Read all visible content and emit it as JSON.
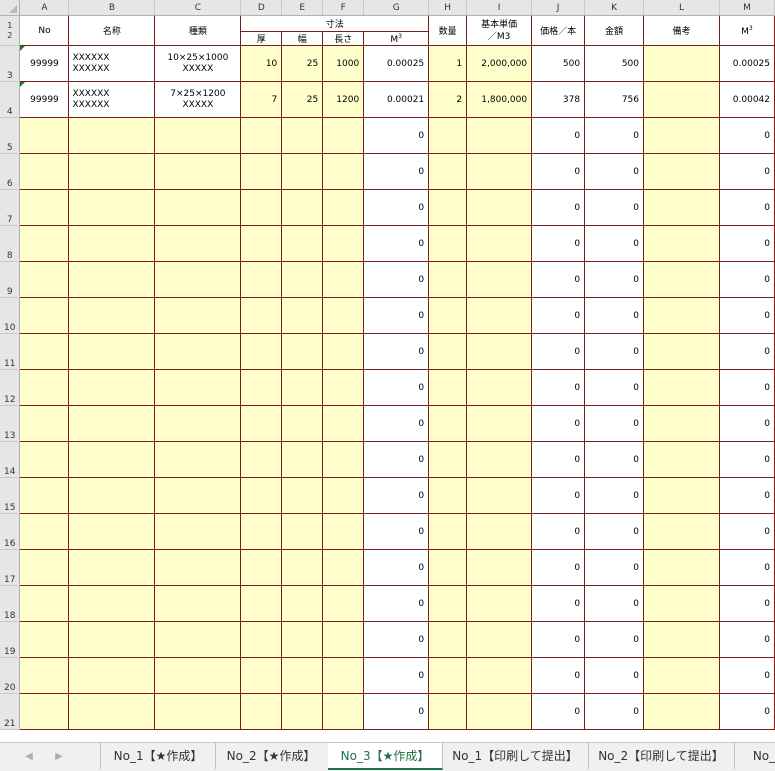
{
  "columns": [
    "A",
    "B",
    "C",
    "D",
    "E",
    "F",
    "G",
    "H",
    "I",
    "J",
    "K",
    "L",
    "M"
  ],
  "row_numbers": [
    "1",
    "2",
    "3",
    "4",
    "5",
    "6",
    "7",
    "8",
    "9",
    "10",
    "11",
    "12",
    "13",
    "14",
    "15",
    "16",
    "17",
    "18",
    "19",
    "20",
    "21"
  ],
  "headers": {
    "no": "No",
    "name": "名称",
    "type": "種類",
    "dimensions": "寸法",
    "thickness": "厚",
    "width": "幅",
    "length": "長さ",
    "volume_m": "M",
    "volume_exp": "3",
    "quantity": "数量",
    "unit_price_line1": "基本単価",
    "unit_price_line2": "／M3",
    "price_per_piece": "価格／本",
    "amount": "金額",
    "remarks": "備考",
    "m3_m": "M",
    "m3_exp": "3"
  },
  "rows": [
    {
      "row": "3",
      "no": "99999",
      "name1": "XXXXXX",
      "name2": "XXXXXX",
      "type1": "10×25×1000",
      "type2": "XXXXX",
      "thickness": "10",
      "width": "25",
      "length": "1000",
      "volume": "0.00025",
      "quantity": "1",
      "unit_price": "2,000,000",
      "price": "500",
      "amount": "500",
      "remarks": "",
      "m3": "0.00025"
    },
    {
      "row": "4",
      "no": "99999",
      "name1": "XXXXXX",
      "name2": "XXXXXX",
      "type1": "7×25×1200",
      "type2": "XXXXX",
      "thickness": "7",
      "width": "25",
      "length": "1200",
      "volume": "0.00021",
      "quantity": "2",
      "unit_price": "1,800,000",
      "price": "378",
      "amount": "756",
      "remarks": "",
      "m3": "0.00042"
    }
  ],
  "zero_value": "0",
  "empty_row_numbers": [
    "5",
    "6",
    "7",
    "8",
    "9",
    "10",
    "11",
    "12",
    "13",
    "14",
    "15",
    "16",
    "17",
    "18",
    "19",
    "20",
    "21"
  ],
  "tabs": [
    {
      "label": "No_1【★作成】",
      "active": false
    },
    {
      "label": "No_2【★作成】",
      "active": false
    },
    {
      "label": "No_3【★作成】",
      "active": true
    },
    {
      "label": "No_1【印刷して提出】",
      "active": false
    },
    {
      "label": "No_2【印刷して提出】",
      "active": false
    },
    {
      "label": "No_",
      "active": false
    }
  ],
  "nav": {
    "prev": "◀",
    "next": "▶"
  }
}
